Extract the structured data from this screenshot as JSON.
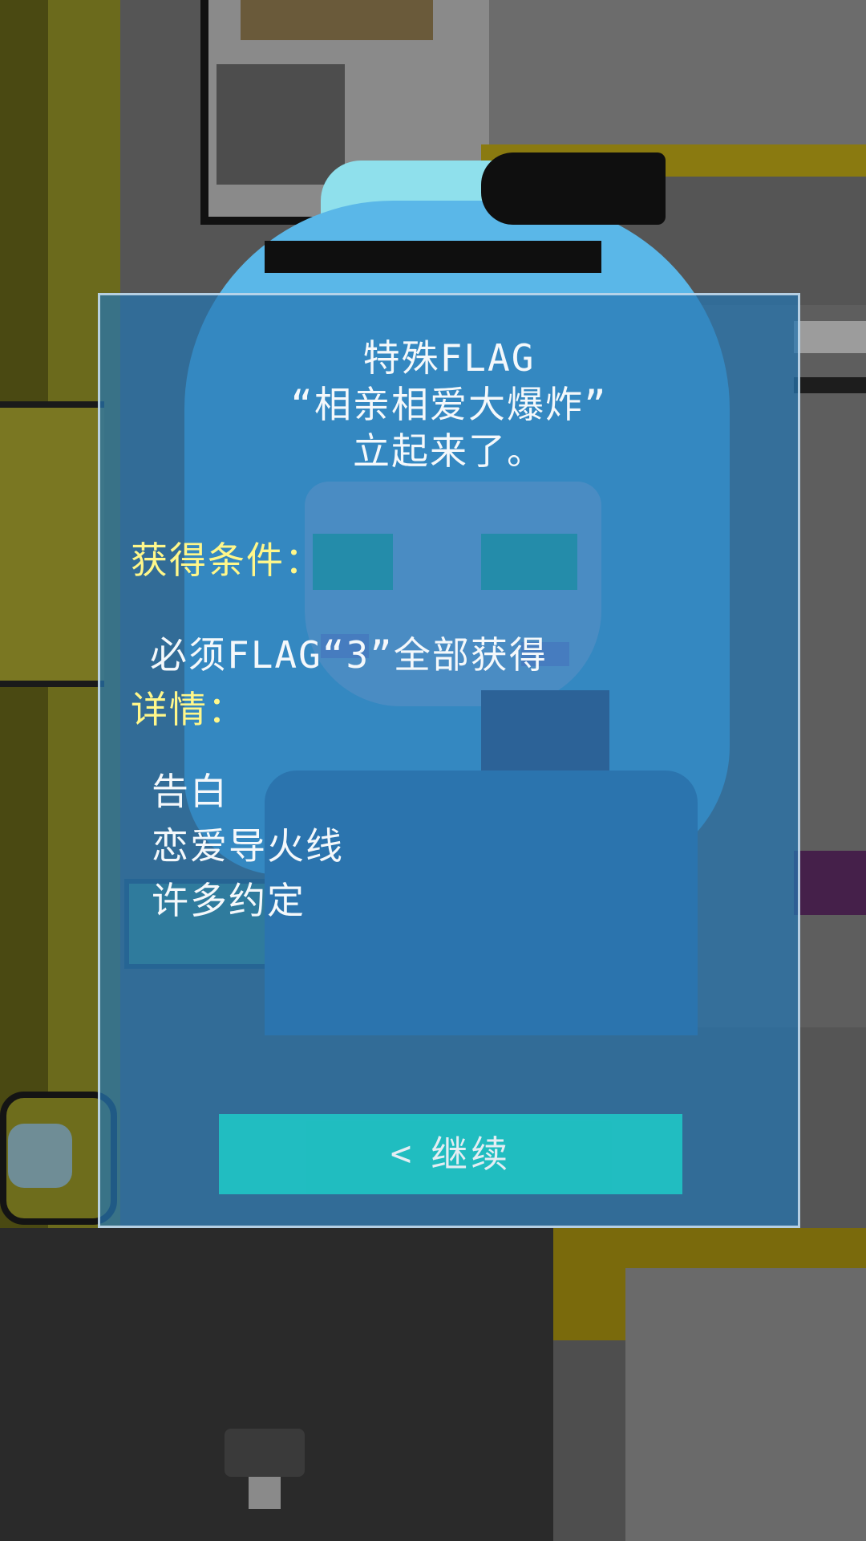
{
  "dialog": {
    "title_lines": [
      "特殊FLAG",
      "“相亲相爱大爆炸”",
      "立起来了。"
    ],
    "condition_label": "获得条件：",
    "condition_text": "必须FLAG“3”全部获得",
    "details_label": "详情：",
    "details_items": [
      "告白",
      "恋爱导火线",
      "许多约定"
    ],
    "continue_label": "继续",
    "continue_icon": "chevron-left-icon"
  },
  "colors": {
    "dialog_bg": "#2676b2",
    "label_yellow": "#fff78a",
    "button": "#1fc4c4",
    "text": "#f4f8fb"
  }
}
